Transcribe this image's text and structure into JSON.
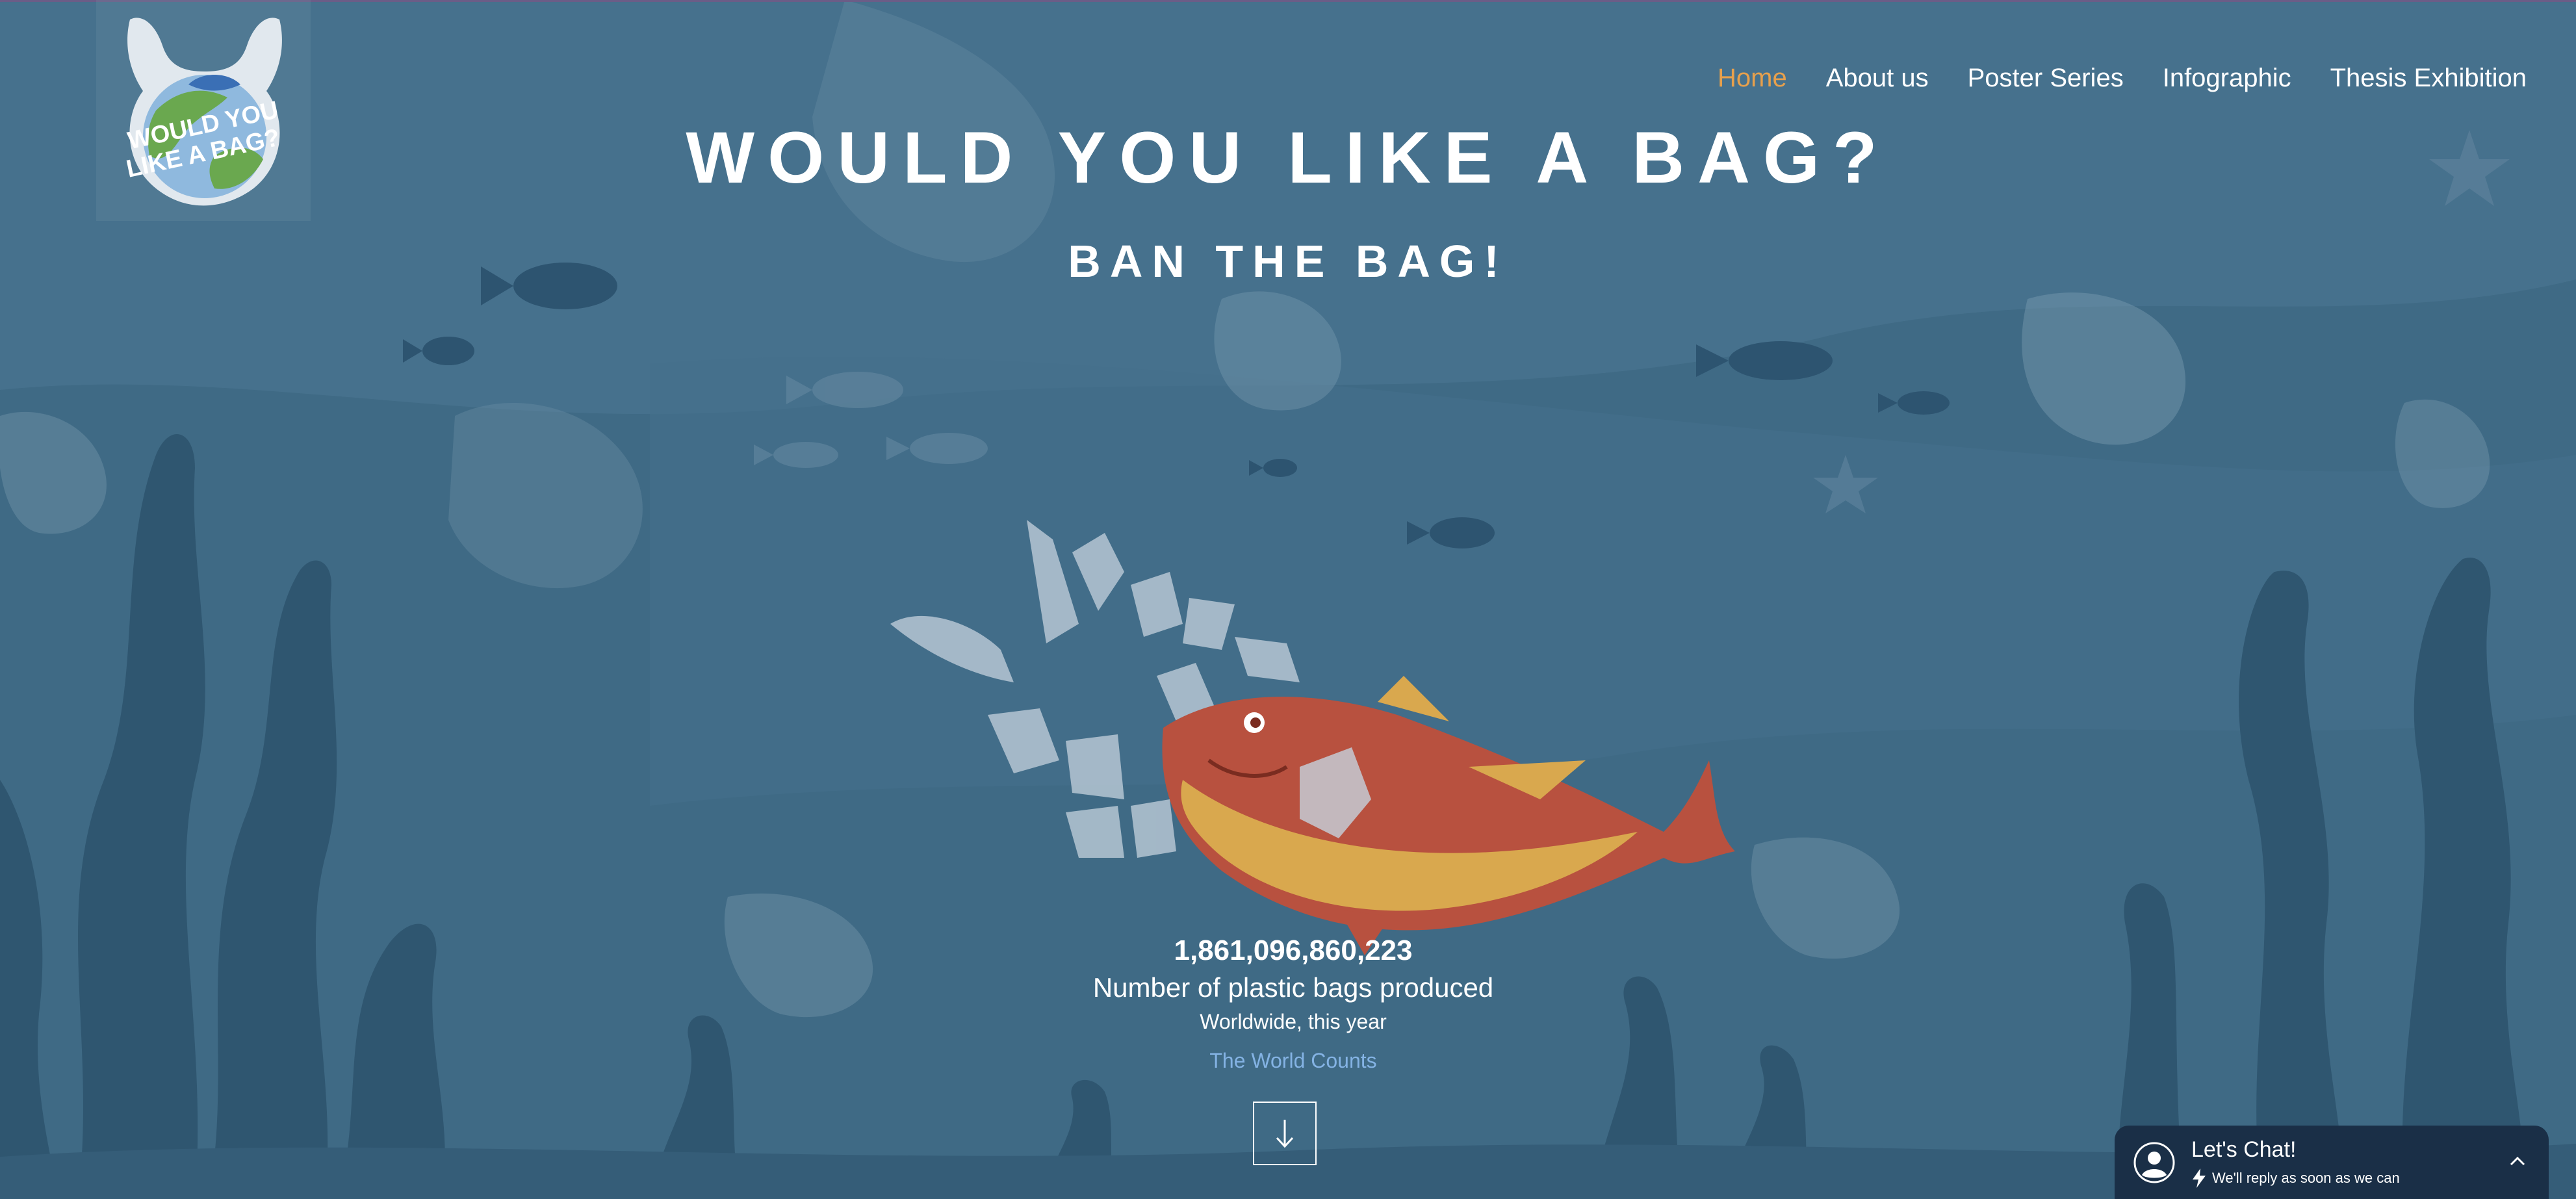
{
  "header": {
    "logo": {
      "text_line1": "WOULD YOU",
      "text_line2": "LIKE A BAG?"
    },
    "nav": [
      {
        "label": "Home",
        "active": true
      },
      {
        "label": "About us",
        "active": false
      },
      {
        "label": "Poster Series",
        "active": false
      },
      {
        "label": "Infographic",
        "active": false
      },
      {
        "label": "Thesis Exhibition",
        "active": false
      }
    ]
  },
  "hero": {
    "title": "WOULD YOU LIKE A BAG?",
    "subtitle": "BAN THE BAG!"
  },
  "counter": {
    "number": "1,861,096,860,223",
    "label": "Number of plastic bags produced",
    "scope": "Worldwide, this year",
    "source": "The World Counts"
  },
  "scroll_button": {
    "icon": "arrow-down-icon"
  },
  "chat_widget": {
    "title": "Let's Chat!",
    "subtitle": "We'll reply as soon as we can",
    "icons": [
      "avatar-icon",
      "bolt-icon",
      "chevron-up-icon"
    ]
  },
  "colors": {
    "background": "#3f6a85",
    "nav_active": "#e7a04c",
    "link": "#84b3e4",
    "chat_bg": "#1a2f47",
    "fish_red": "#b8513f",
    "fish_gold": "#d9a84e"
  }
}
